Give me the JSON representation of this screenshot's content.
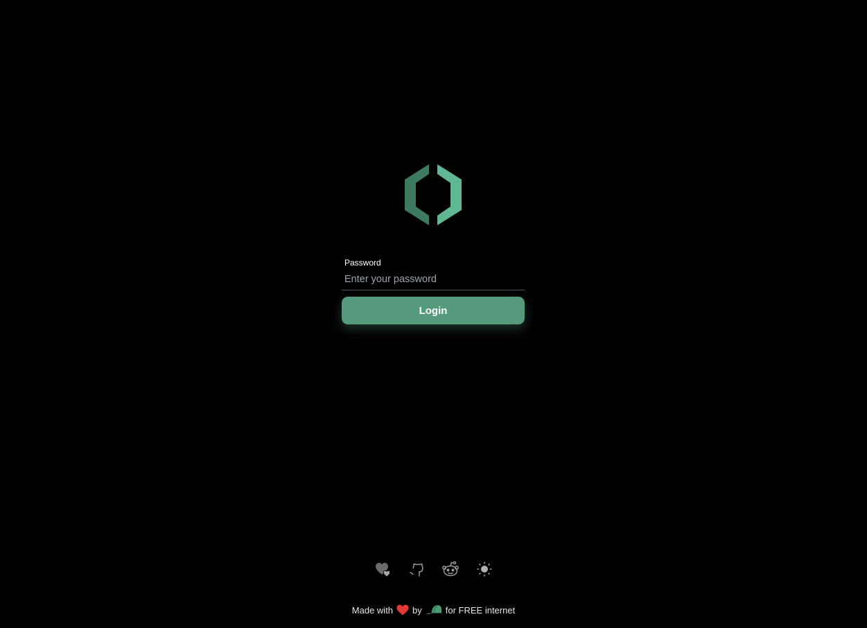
{
  "logo": {
    "icon": "hexagon-brackets-logo",
    "colors": {
      "left": "#3d7a60",
      "right": "#5fb893"
    }
  },
  "login_form": {
    "password_label": "Password",
    "password_placeholder": "Enter your password",
    "password_value": "",
    "login_button_label": "Login"
  },
  "footer_icons": [
    {
      "name": "donate-hearts-icon"
    },
    {
      "name": "github-icon"
    },
    {
      "name": "reddit-icon"
    },
    {
      "name": "theme-toggle-sun-icon"
    }
  ],
  "footer": {
    "made_with": "Made with",
    "by": "by",
    "tagline": "for FREE internet",
    "heart_color": "#e53935",
    "cap_color": "#4a9a72"
  },
  "colors": {
    "background": "#000000",
    "accent": "#559a7d",
    "icon_gray": "#8a8a8a"
  }
}
